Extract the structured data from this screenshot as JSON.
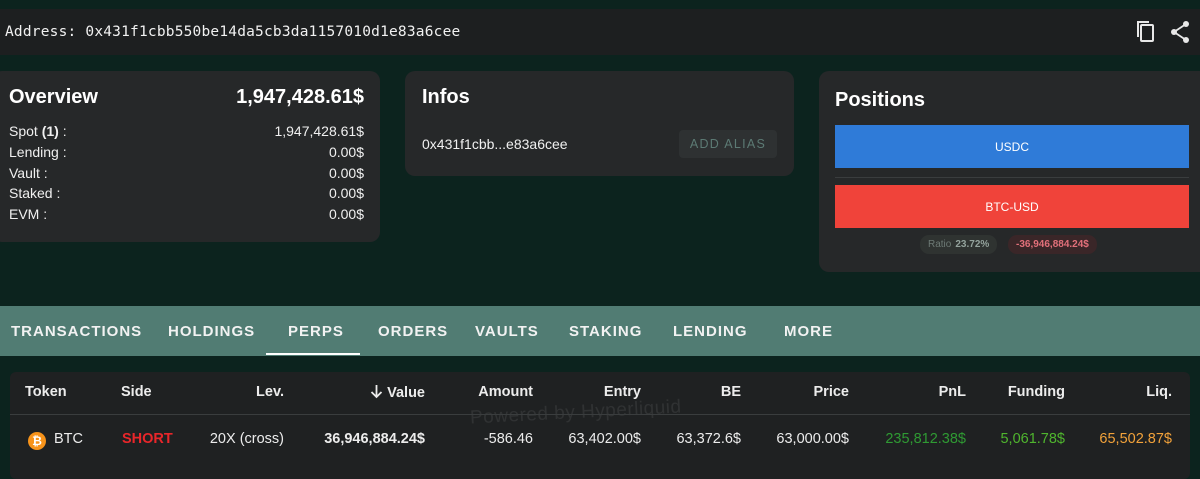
{
  "address_bar": {
    "label": "Address:",
    "address": "0x431f1cbb550be14da5cb3da1157010d1e83a6cee",
    "icons": [
      "copy-icon",
      "share-icon"
    ]
  },
  "overview": {
    "title": "Overview",
    "total": "1,947,428.61$",
    "rows": [
      {
        "label": "Spot",
        "count": "(1)",
        "suffix": " :",
        "value": "1,947,428.61$"
      },
      {
        "label": "Lending :",
        "value": "0.00$"
      },
      {
        "label": "Vault :",
        "value": "0.00$"
      },
      {
        "label": "Staked :",
        "value": "0.00$"
      },
      {
        "label": "EVM :",
        "value": "0.00$"
      }
    ]
  },
  "infos": {
    "title": "Infos",
    "short_address": "0x431f1cbb...e83a6cee",
    "alias_button": "ADD ALIAS"
  },
  "positions": {
    "title": "Positions",
    "bars": [
      {
        "label": "USDC",
        "color": "#2f7bd8"
      },
      {
        "label": "BTC-USD",
        "color": "#f0433a"
      }
    ],
    "ratio_label": "Ratio",
    "ratio_value": "23.72%",
    "pnl_chip": "-36,946,884.24$"
  },
  "tabs": [
    "TRANSACTIONS",
    "HOLDINGS",
    "PERPS",
    "ORDERS",
    "VAULTS",
    "STAKING",
    "LENDING",
    "MORE"
  ],
  "active_tab": "PERPS",
  "table": {
    "watermark": "Powered by Hyperliquid",
    "columns": [
      "Token",
      "Side",
      "Lev.",
      "Value",
      "Amount",
      "Entry",
      "BE",
      "Price",
      "PnL",
      "Funding",
      "Liq."
    ],
    "sort_icon": "arrow-down-icon",
    "rows": [
      {
        "token": "BTC",
        "token_icon": "bitcoin-icon",
        "side": "SHORT",
        "lev": "20X (cross)",
        "value": "36,946,884.24$",
        "amount": "-586.46",
        "entry": "63,402.00$",
        "be": "63,372.6$",
        "price": "63,000.00$",
        "pnl": "235,812.38$",
        "funding": "5,061.78$",
        "liq": "65,502.87$"
      }
    ],
    "colors": {
      "short": "#e8262a",
      "pnl": "#2f9a33",
      "funding": "#4fb52e",
      "liq": "#f2a23a"
    }
  }
}
